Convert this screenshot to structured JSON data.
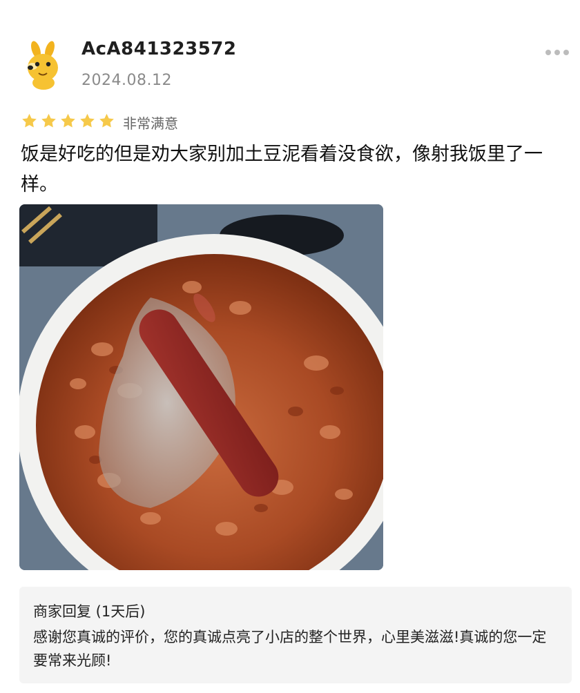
{
  "review": {
    "username": "AcA841323572",
    "date": "2024.08.12",
    "rating_stars": 5,
    "rating_text": "非常满意",
    "text": "饭是好吃的但是劝大家别加土豆泥看着没食欲，像射我饭里了一样。",
    "star_color": "#f6c94a",
    "avatar_icon": "yellow-dog-icon",
    "more_icon": "more-dots-icon"
  },
  "merchant_reply": {
    "title": "商家回复 (1天后)",
    "text": "感谢您真诚的评价，您的真诚点亮了小店的整个世界，心里美滋滋!真诚的您一定要常来光顾!"
  }
}
